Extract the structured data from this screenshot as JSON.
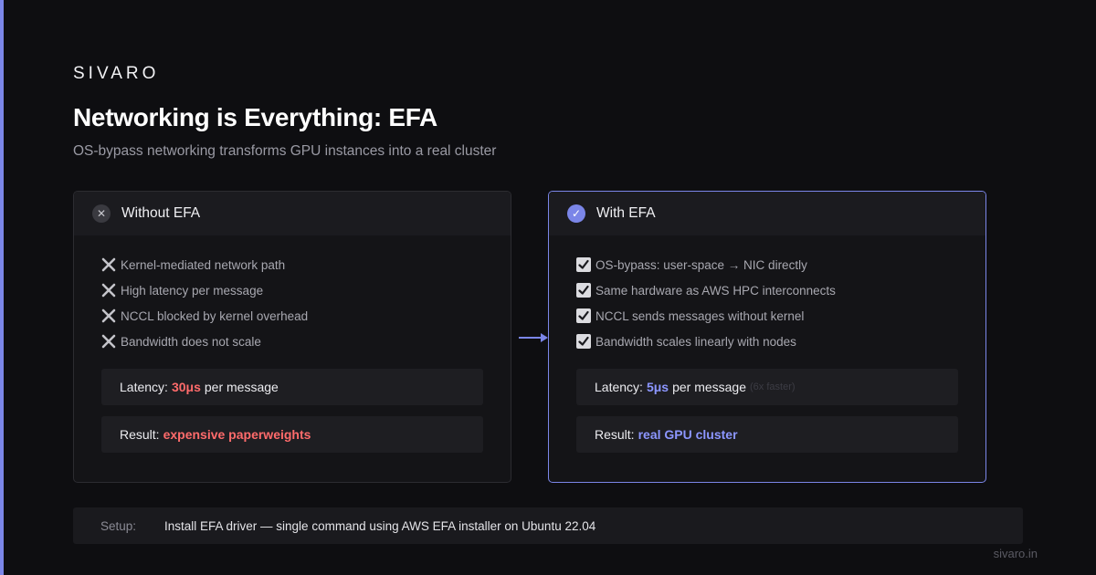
{
  "brand": "SIVARO",
  "title": "Networking is Everything: EFA",
  "subtitle": "OS-bypass networking transforms GPU instances into a real cluster",
  "colors": {
    "accent": "#7b86e8",
    "bad": "#ff6b6b",
    "good": "#8c96ff",
    "background": "#0e0e11"
  },
  "without": {
    "heading": "Without EFA",
    "icon": "close-icon",
    "items": [
      "Kernel-mediated network path",
      "High latency per message",
      "NCCL blocked by kernel overhead",
      "Bandwidth does not scale"
    ],
    "latency_label": "Latency:",
    "latency_value": "30μs",
    "latency_suffix": "per message",
    "result_label": "Result:",
    "result_value": "expensive paperweights"
  },
  "with": {
    "heading": "With EFA",
    "icon": "check-icon",
    "items": [
      "OS-bypass: user-space → NIC directly",
      "Same hardware as AWS HPC interconnects",
      "NCCL sends messages without kernel",
      "Bandwidth scales linearly with nodes"
    ],
    "latency_label": "Latency:",
    "latency_value": "5μs",
    "latency_suffix": "per message",
    "latency_note": "(6x faster)",
    "result_label": "Result:",
    "result_value": "real GPU cluster"
  },
  "setup": {
    "label": "Setup:",
    "text": "Install EFA driver — single command using AWS EFA installer on Ubuntu 22.04"
  },
  "footer": "sivaro.in"
}
